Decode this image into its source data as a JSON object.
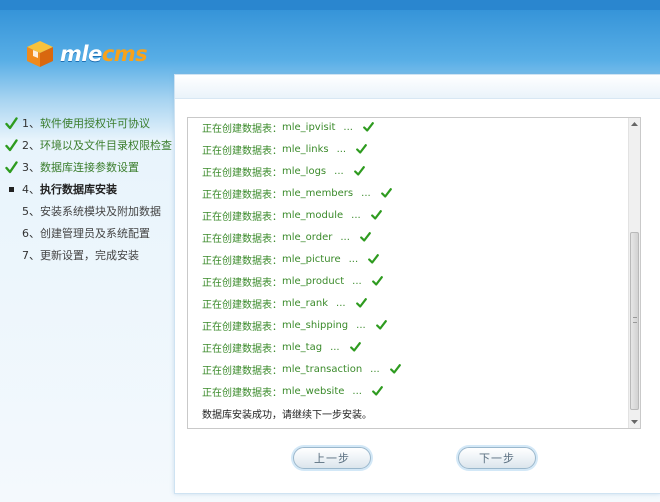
{
  "brand": {
    "logo_text_white": "mle",
    "logo_text_orange": "cms",
    "logo_icon": "cube-logo-icon"
  },
  "steps": [
    {
      "num": "1、",
      "label": "软件使用授权许可协议",
      "state": "done"
    },
    {
      "num": "2、",
      "label": "环境以及文件目录权限检查",
      "state": "done"
    },
    {
      "num": "3、",
      "label": "数据库连接参数设置",
      "state": "done"
    },
    {
      "num": "4、",
      "label": "执行数据库安装",
      "state": "current"
    },
    {
      "num": "5、",
      "label": "安装系统模块及附加数据",
      "state": "todo"
    },
    {
      "num": "6、",
      "label": "创建管理员及系统配置",
      "state": "todo"
    },
    {
      "num": "7、",
      "label": "更新设置，完成安装",
      "state": "todo"
    }
  ],
  "log": {
    "prefix": "正在创建数据表：",
    "dots": "...",
    "tables": [
      "mle_ipvisit",
      "mle_links",
      "mle_logs",
      "mle_members",
      "mle_module",
      "mle_order",
      "mle_picture",
      "mle_product",
      "mle_rank",
      "mle_shipping",
      "mle_tag",
      "mle_transaction",
      "mle_website"
    ],
    "done_message": "数据库安装成功，请继续下一步安装。"
  },
  "buttons": {
    "prev_label": "上一步",
    "next_label": "下一步"
  },
  "colors": {
    "check": "#2e9b1f",
    "log_text": "#3a8a2a",
    "accent_blue": "#2f8fd6",
    "logo_orange": "#f7a21b"
  }
}
